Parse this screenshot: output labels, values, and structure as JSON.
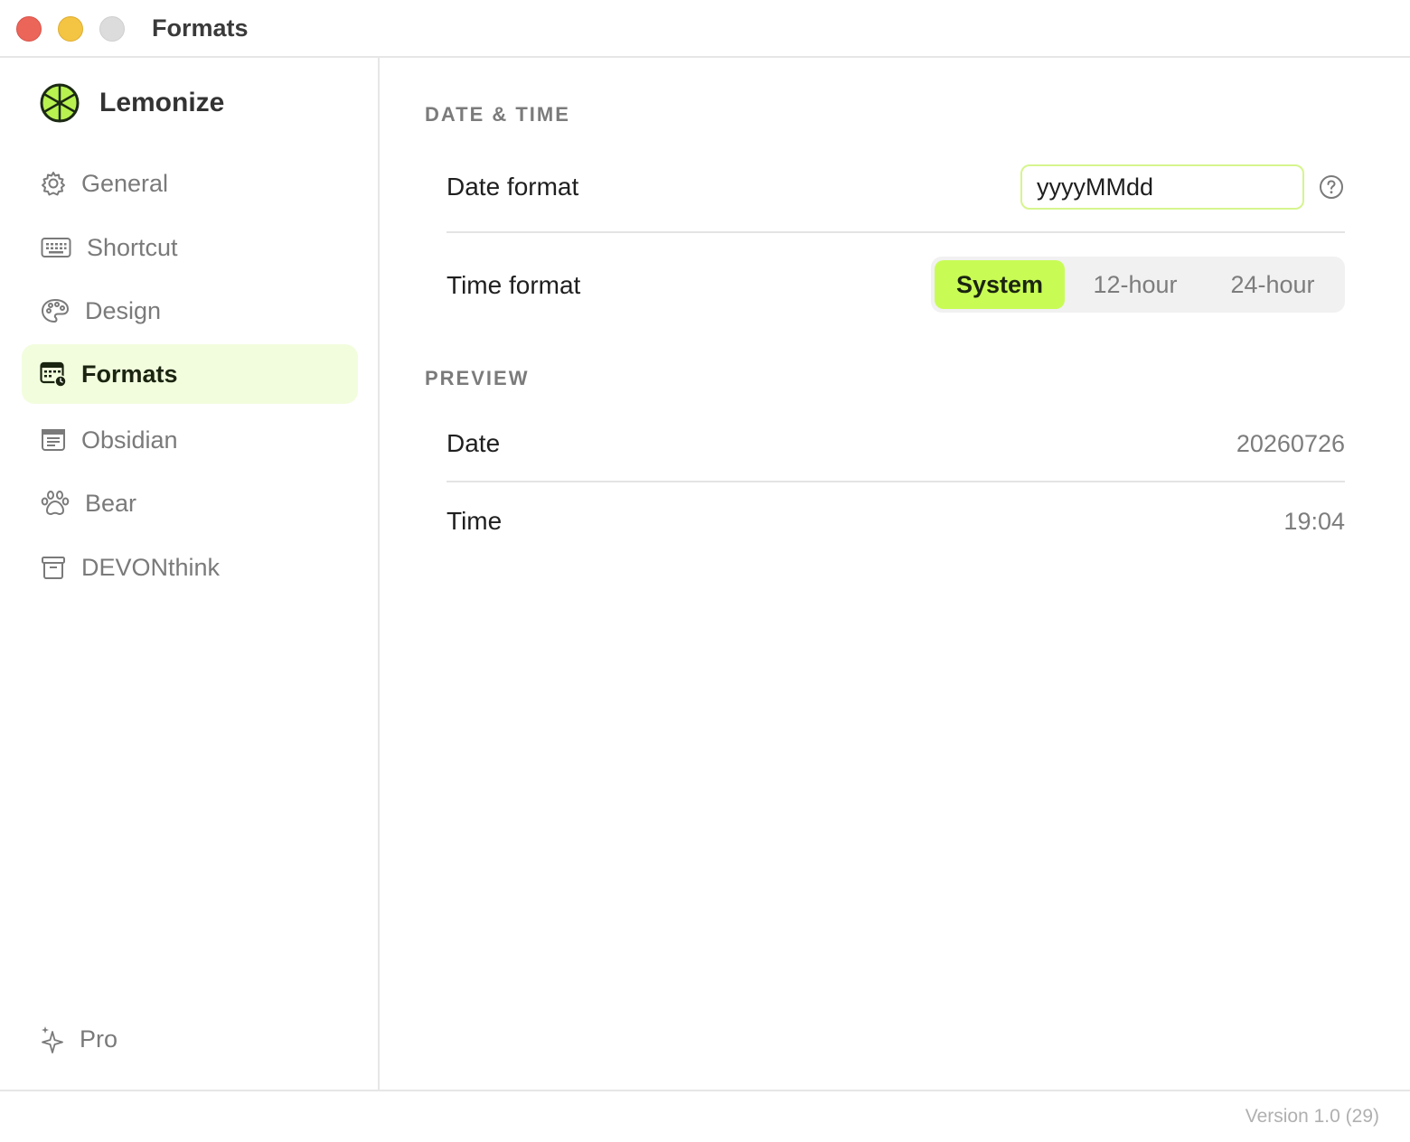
{
  "window": {
    "title": "Formats"
  },
  "sidebar": {
    "brand": "Lemonize",
    "items": [
      {
        "label": "General",
        "icon": "gear-icon"
      },
      {
        "label": "Shortcut",
        "icon": "keyboard-icon"
      },
      {
        "label": "Design",
        "icon": "palette-icon"
      },
      {
        "label": "Formats",
        "icon": "calendar-clock-icon",
        "active": true
      },
      {
        "label": "Obsidian",
        "icon": "note-icon"
      },
      {
        "label": "Bear",
        "icon": "paw-icon"
      },
      {
        "label": "DEVONthink",
        "icon": "archive-box-icon"
      }
    ],
    "pro_label": "Pro"
  },
  "main": {
    "date_time_section": "DATE & TIME",
    "date_format_label": "Date format",
    "date_format_value": "yyyyMMdd",
    "time_format_label": "Time format",
    "time_format_options": [
      "System",
      "12-hour",
      "24-hour"
    ],
    "time_format_selected": "System",
    "preview_section": "PREVIEW",
    "preview_date_label": "Date",
    "preview_date_value": "20260726",
    "preview_time_label": "Time",
    "preview_time_value": "19:04"
  },
  "footer": {
    "version": "Version 1.0 (29)"
  },
  "colors": {
    "accent": "#c8fc55",
    "active_bg": "#f2fdde",
    "input_border": "#d6f58e",
    "close": "#ec6559",
    "minimize": "#f4c443",
    "zoom": "#dcdcdc"
  }
}
